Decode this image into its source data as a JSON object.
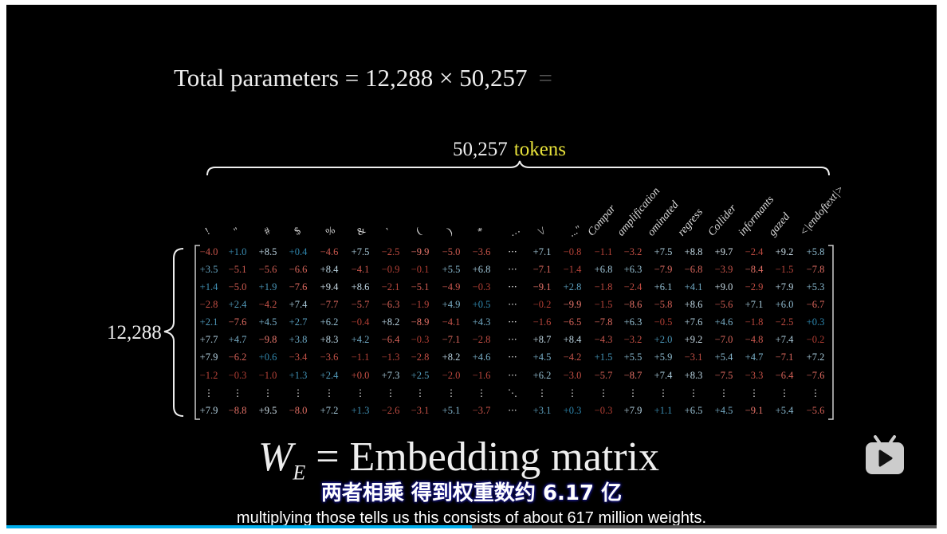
{
  "equation": {
    "text": "Total parameters = 12,288 × 50,257",
    "ghost": "="
  },
  "tokens": {
    "count": "50,257",
    "label": "tokens"
  },
  "rows_label": "12,288",
  "formula": {
    "w": "W",
    "sub": "E",
    "rest": " = Embedding matrix"
  },
  "subtitles": {
    "chinese": "两者相乘  得到权重数约 6.17 亿",
    "english": "multiplying those tells us this consists of about 617 million weights."
  },
  "colors": {
    "positive": "#3f9cc4",
    "negative": "#d0574a",
    "progress": "#00aeec"
  },
  "progress": 0.5,
  "headers": [
    "!",
    "\"",
    "#",
    "$",
    "%",
    "&",
    "'",
    "(",
    ")",
    "*",
    "…",
    "\\/",
    "...\"",
    "Compar",
    "amplification",
    "ominated",
    "regress",
    "Collider",
    "informants",
    "gazed",
    "<|endoftext|>"
  ],
  "matrix": [
    [
      "−4.0",
      "+1.0",
      "+8.5",
      "+0.4",
      "−4.6",
      "+7.5",
      "−2.5",
      "−9.9",
      "−5.0",
      "−3.6",
      "+7.1",
      "−0.8",
      "−1.1",
      "−3.2",
      "+7.5",
      "+8.8",
      "+9.7",
      "−2.4",
      "+9.2",
      "+5.8"
    ],
    [
      "+3.5",
      "−5.1",
      "−5.6",
      "−6.6",
      "+8.4",
      "−4.1",
      "−0.9",
      "−0.1",
      "+5.5",
      "+6.8",
      "−7.1",
      "−1.4",
      "+6.8",
      "+6.3",
      "−7.9",
      "−6.8",
      "−3.9",
      "−8.4",
      "−1.5",
      "−7.8"
    ],
    [
      "+1.4",
      "−5.0",
      "+1.9",
      "−7.6",
      "+9.4",
      "+8.6",
      "−2.1",
      "−5.1",
      "−4.9",
      "−0.3",
      "−9.1",
      "+2.8",
      "−1.8",
      "−2.4",
      "+6.1",
      "+4.1",
      "+9.0",
      "−2.9",
      "+7.9",
      "+5.3"
    ],
    [
      "−2.8",
      "+2.4",
      "−4.2",
      "+7.4",
      "−7.7",
      "−5.7",
      "−6.3",
      "−1.9",
      "+4.9",
      "+0.5",
      "−0.2",
      "−9.9",
      "−1.5",
      "−8.6",
      "−5.8",
      "+8.6",
      "−5.6",
      "+7.1",
      "+6.0",
      "−6.7"
    ],
    [
      "+2.1",
      "−7.6",
      "+4.5",
      "+2.7",
      "+6.2",
      "−0.4",
      "+8.2",
      "−8.9",
      "−4.1",
      "+4.3",
      "−1.6",
      "−6.5",
      "−7.8",
      "+6.3",
      "−0.5",
      "+7.6",
      "+4.6",
      "−1.8",
      "−2.5",
      "+0.3"
    ],
    [
      "+7.7",
      "+4.7",
      "−9.8",
      "+3.8",
      "+8.3",
      "+4.2",
      "−6.4",
      "−0.3",
      "−7.1",
      "−2.8",
      "+8.7",
      "+8.4",
      "−4.3",
      "−3.2",
      "+2.0",
      "+9.2",
      "−7.0",
      "−4.8",
      "+7.4",
      "−0.2"
    ],
    [
      "+7.9",
      "−6.2",
      "+0.6",
      "−3.4",
      "−3.6",
      "−1.1",
      "−1.3",
      "−2.8",
      "+8.2",
      "+4.6",
      "+4.5",
      "−4.2",
      "+1.5",
      "+5.5",
      "+5.9",
      "−3.1",
      "+5.4",
      "+4.7",
      "−7.1",
      "+7.2"
    ],
    [
      "−1.2",
      "−0.3",
      "−1.0",
      "+1.3",
      "+2.4",
      "+0.0",
      "+7.3",
      "+2.5",
      "−2.0",
      "−1.6",
      "+6.2",
      "−3.0",
      "−5.7",
      "−8.7",
      "+7.4",
      "+8.3",
      "−7.5",
      "−3.3",
      "−6.4",
      "−7.6"
    ]
  ],
  "last_row": [
    "+7.9",
    "−8.8",
    "+9.5",
    "−8.0",
    "+7.2",
    "+1.3",
    "−2.6",
    "−3.1",
    "+5.1",
    "−3.7",
    "+3.1",
    "+0.3",
    "−0.3",
    "+7.9",
    "+1.1",
    "+6.5",
    "+4.5",
    "−9.1",
    "+5.4",
    "−5.6"
  ],
  "ellipsis": {
    "h": "···",
    "v": "⋮",
    "d": "⋱"
  }
}
